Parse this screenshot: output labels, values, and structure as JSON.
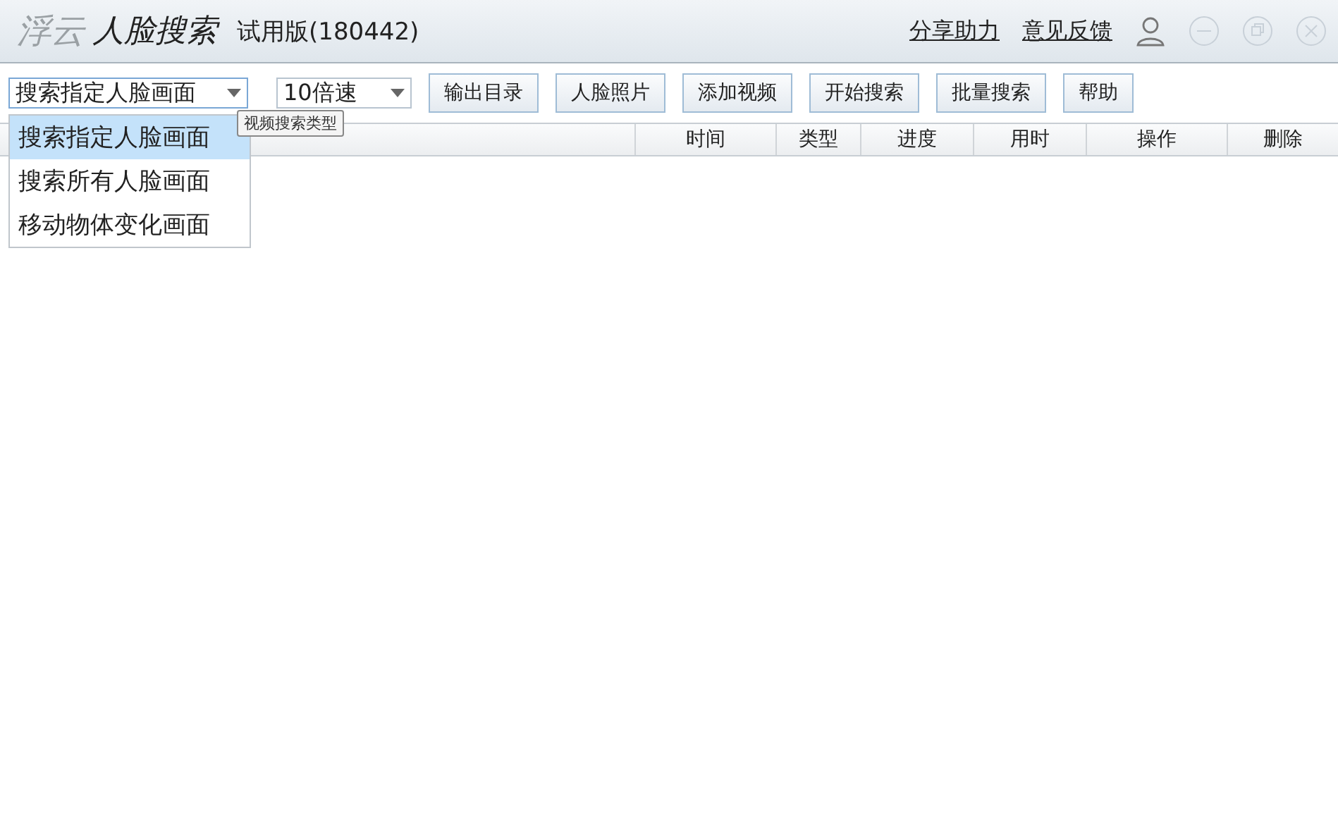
{
  "app": {
    "logo": "浮云",
    "title": "人脸搜索",
    "edition": "试用版(180442)"
  },
  "header_links": [
    "分享助力",
    "意见反馈"
  ],
  "toolbar": {
    "search_type": {
      "value": "搜索指定人脸画面",
      "expanded": true,
      "tooltip": "视频搜索类型",
      "options": [
        {
          "label": "搜索指定人脸画面",
          "selected": true
        },
        {
          "label": "搜索所有人脸画面",
          "selected": false
        },
        {
          "label": "移动物体变化画面",
          "selected": false
        }
      ]
    },
    "speed": {
      "value": "10倍速"
    },
    "buttons": [
      "输出目录",
      "人脸照片",
      "添加视频",
      "开始搜索",
      "批量搜索",
      "帮助"
    ]
  },
  "table": {
    "columns": [
      "时间",
      "类型",
      "进度",
      "用时",
      "操作",
      "删除"
    ]
  }
}
